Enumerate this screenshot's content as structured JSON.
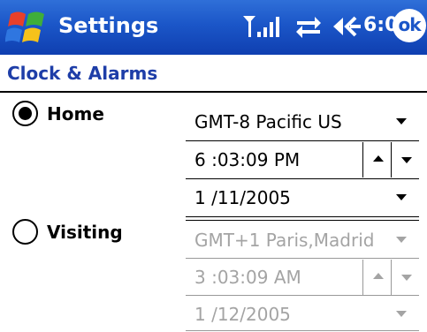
{
  "titlebar": {
    "title": "Settings",
    "time": "6:03",
    "ok_label": "ok",
    "icons": [
      "windows-start-icon",
      "signal-icon",
      "sync-icon",
      "volume-icon"
    ]
  },
  "page": {
    "title": "Clock & Alarms"
  },
  "home": {
    "label": "Home",
    "selected": true,
    "timezone": "GMT-8 Pacific US",
    "time": "6 :03:09 PM",
    "date": "1 /11/2005"
  },
  "visiting": {
    "label": "Visiting",
    "selected": false,
    "timezone": "GMT+1 Paris,Madrid",
    "time": "3 :03:09 AM",
    "date": "1 /12/2005"
  },
  "colors": {
    "titlebar": "#1b56c8",
    "page_title": "#1e3ea8",
    "disabled_text": "#a4a4a4"
  }
}
